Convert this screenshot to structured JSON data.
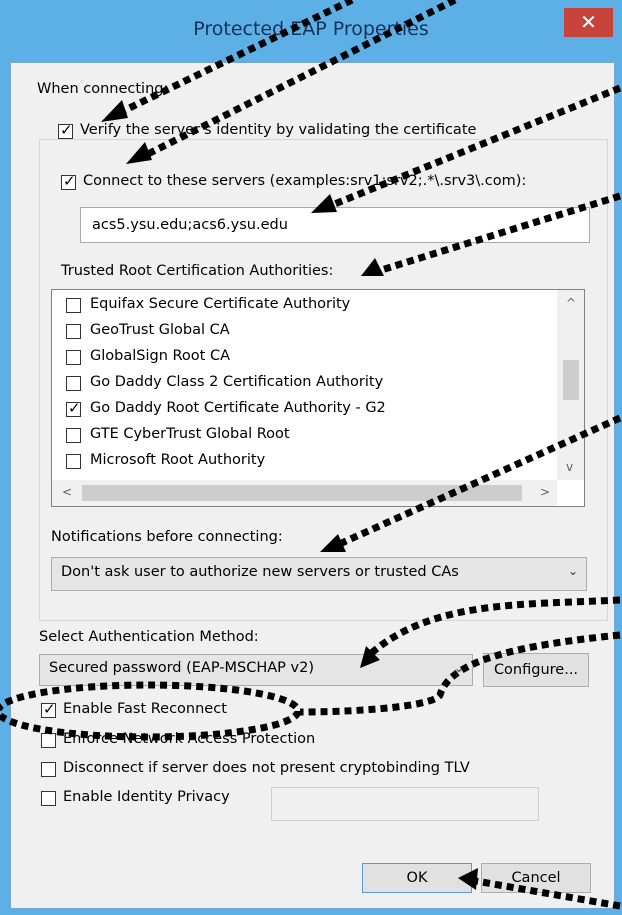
{
  "window": {
    "title": "Protected EAP Properties",
    "close_glyph": "✕"
  },
  "connecting": {
    "heading": "When connecting:",
    "verify_label": "Verify the server's identity by validating the certificate",
    "verify_checked": true,
    "connect_label": "Connect to these servers (examples:srv1;srv2;.*\\.srv3\\.com):",
    "connect_checked": true,
    "servers_value": "acs5.ysu.edu;acs6.ysu.edu",
    "trusted_heading": "Trusted Root Certification Authorities:",
    "trusted_list": [
      {
        "label": "Equifax Secure Certificate Authority",
        "checked": false
      },
      {
        "label": "GeoTrust Global CA",
        "checked": false
      },
      {
        "label": "GlobalSign Root CA",
        "checked": false
      },
      {
        "label": "Go Daddy Class 2 Certification Authority",
        "checked": false
      },
      {
        "label": "Go Daddy Root Certificate Authority - G2",
        "checked": true
      },
      {
        "label": "GTE CyberTrust Global Root",
        "checked": false
      },
      {
        "label": "Microsoft Root Authority",
        "checked": false
      }
    ],
    "notifications_heading": "Notifications before connecting:",
    "notifications_value": "Don't ask user to authorize new servers or trusted CAs"
  },
  "auth": {
    "heading": "Select Authentication Method:",
    "method_value": "Secured password (EAP-MSCHAP v2)",
    "configure_label": "Configure..."
  },
  "options": [
    {
      "label": "Enable Fast Reconnect",
      "checked": true
    },
    {
      "label": "Enforce Network Access Protection",
      "checked": false
    },
    {
      "label": "Disconnect if server does not present cryptobinding TLV",
      "checked": false
    },
    {
      "label": "Enable Identity Privacy",
      "checked": false
    }
  ],
  "identity_privacy_value": "",
  "buttons": {
    "ok": "OK",
    "cancel": "Cancel"
  },
  "icons": {
    "check": "✓",
    "chevron_down": "⌄",
    "scroll_up": "^",
    "scroll_down": "v",
    "scroll_left": "<",
    "scroll_right": ">"
  },
  "colors": {
    "title_bar": "#5db0e6",
    "close_button": "#c7443b",
    "dialog_bg": "#f0f0f0"
  }
}
